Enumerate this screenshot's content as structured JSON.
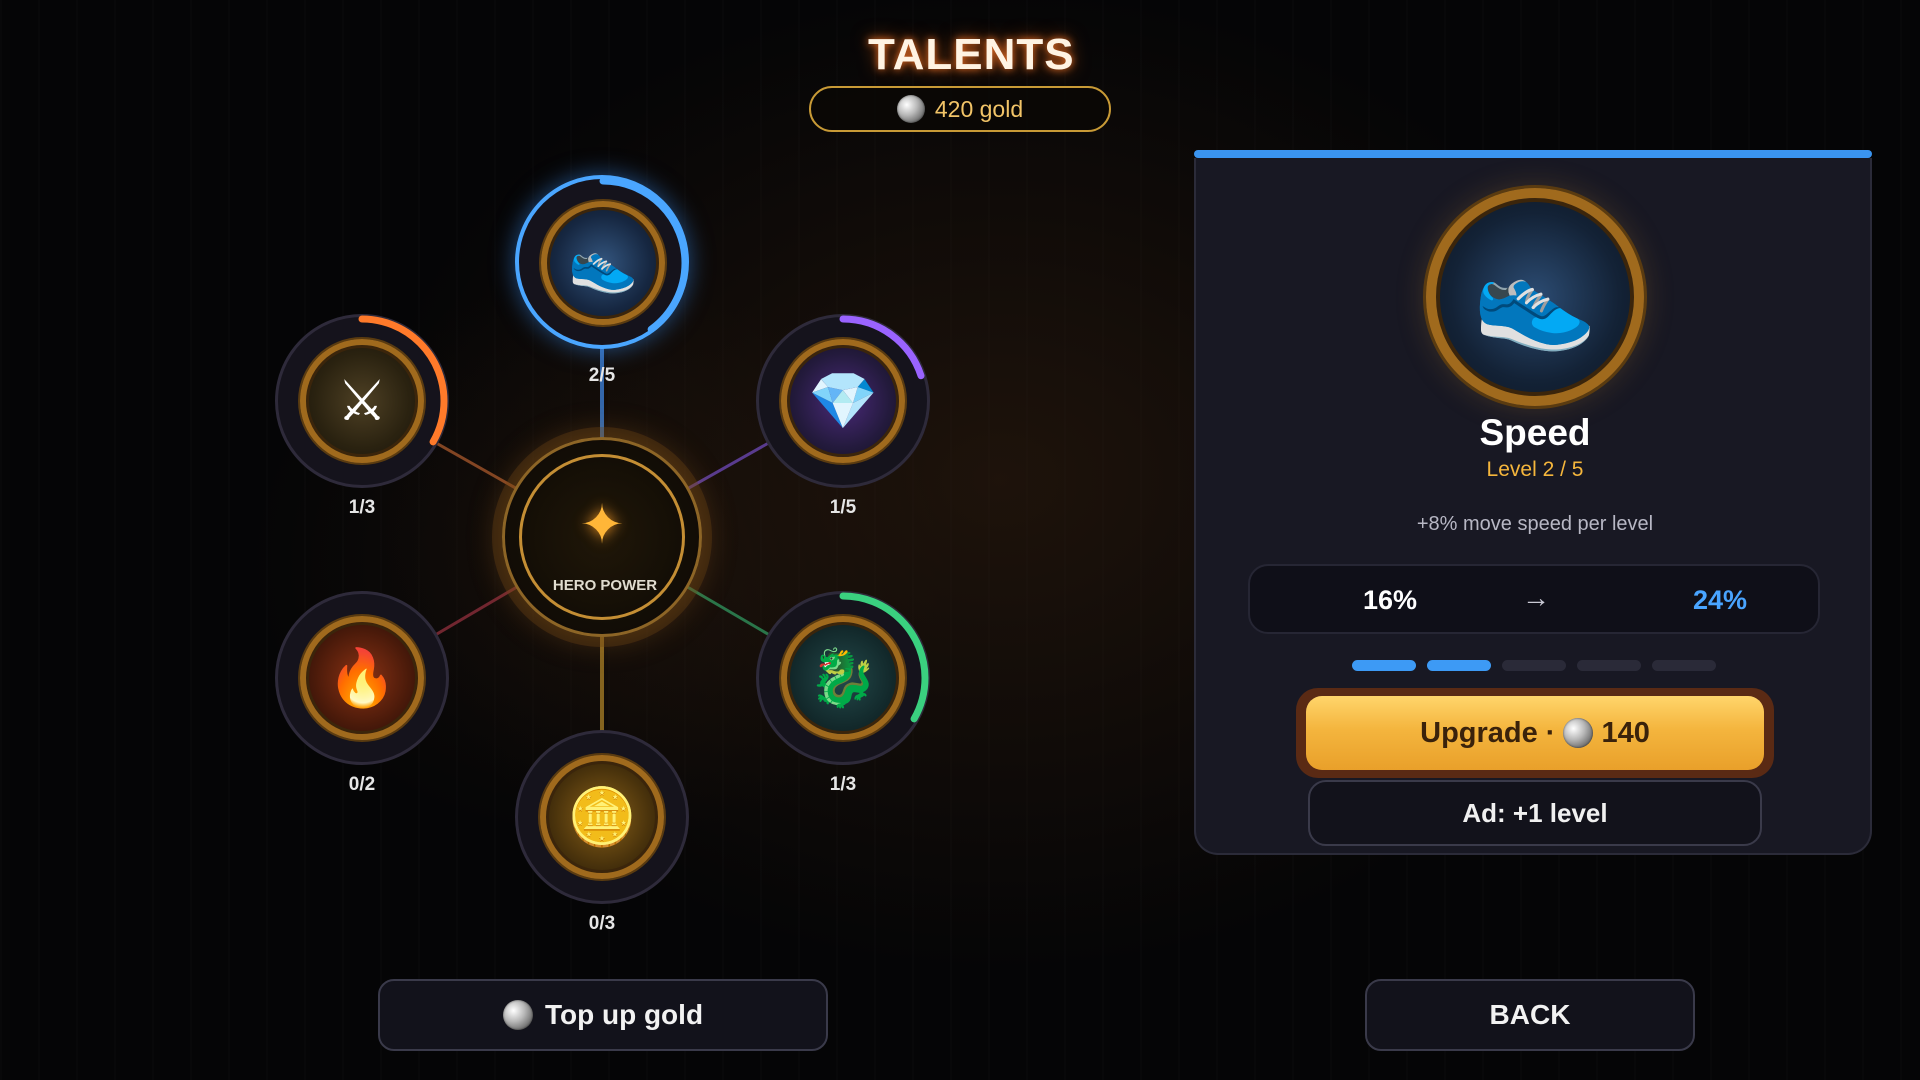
{
  "screen": {
    "title": "TALENTS",
    "gold_text": "420 gold"
  },
  "tree": {
    "hub_label": "HERO POWER",
    "nodes": [
      {
        "id": "speed",
        "icon": "winged-boot-icon",
        "level_text": "2/5",
        "progress": 0.4,
        "color": "#4aa6ff",
        "selected": true
      },
      {
        "id": "lightning-sword",
        "icon": "lightning-sword-icon",
        "level_text": "1/3",
        "progress": 0.333,
        "color": "#ff7a2a"
      },
      {
        "id": "crystal",
        "icon": "crystal-icon",
        "level_text": "1/5",
        "progress": 0.2,
        "color": "#9a63ff"
      },
      {
        "id": "fire-heart",
        "icon": "fire-heart-icon",
        "level_text": "0/2",
        "progress": 0,
        "color": "#e0455a"
      },
      {
        "id": "dragon",
        "icon": "dragon-icon",
        "level_text": "1/3",
        "progress": 0.333,
        "color": "#3ad07f"
      },
      {
        "id": "gold-pile",
        "icon": "gold-pile-icon",
        "level_text": "0/3",
        "progress": 0,
        "color": "#d8a43a"
      }
    ]
  },
  "detail": {
    "icon": "winged-boot-icon",
    "name": "Speed",
    "level": "Level 2 / 5",
    "description": "+8% move speed per level",
    "current_value": "16%",
    "next_value": "24%",
    "pips_total": 5,
    "pips_filled": 2,
    "upgrade_label": "Upgrade ·",
    "upgrade_cost": "140",
    "ad_label": "Ad: +1 level"
  },
  "footer": {
    "top_up_label": "Top up gold",
    "back_label": "BACK"
  },
  "colors": {
    "accent_blue": "#3a94f0",
    "gold": "#f5b63c",
    "upgrade_button": "#f4b53e"
  }
}
